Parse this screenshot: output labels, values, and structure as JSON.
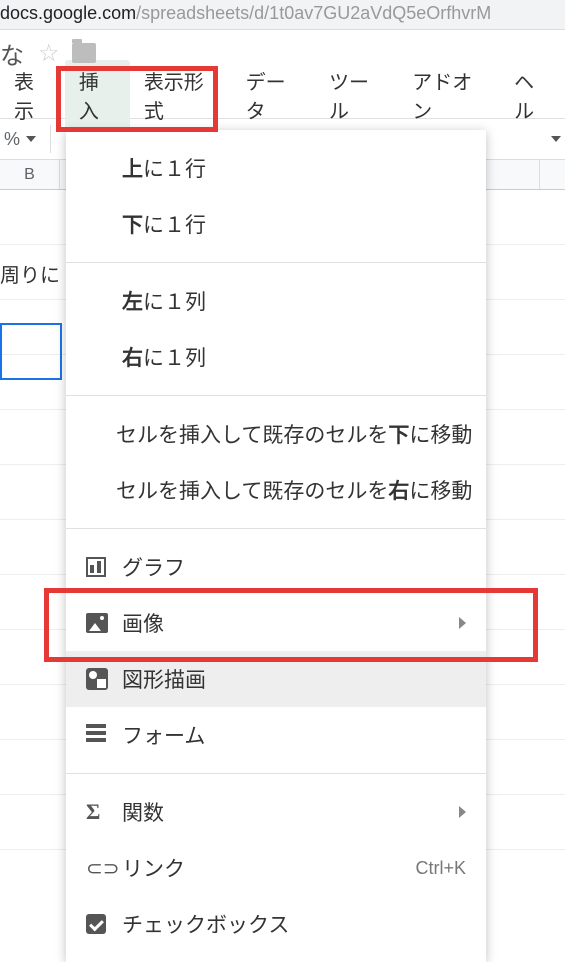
{
  "url": {
    "domain": "docs.google.com",
    "path": "/spreadsheets/d/1t0av7GU2aVdQ5eOrfhvrM"
  },
  "titlebar": {
    "docname_fragment": "な"
  },
  "menubar": {
    "items": [
      "表示",
      "挿入",
      "表示形式",
      "データ",
      "ツール",
      "アドオン",
      "ヘル"
    ]
  },
  "toolbar": {
    "percent_suffix": "%"
  },
  "columns": {
    "B": "B"
  },
  "cell_text": {
    "row1": "周りに"
  },
  "dropdown": {
    "row_above_prefix": "上",
    "row_above_rest": "に１行",
    "row_below_prefix": "下",
    "row_below_rest": "に１行",
    "col_left_prefix": "左",
    "col_left_rest": "に１列",
    "col_right_prefix": "右",
    "col_right_rest": "に１列",
    "shift_down_a": "セルを挿入して既存のセルを",
    "shift_down_b": "下",
    "shift_down_c": "に移動",
    "shift_right_a": "セルを挿入して既存のセルを",
    "shift_right_b": "右",
    "shift_right_c": "に移動",
    "chart": "グラフ",
    "image": "画像",
    "drawing": "図形描画",
    "form": "フォーム",
    "function": "関数",
    "link": "リンク",
    "link_shortcut": "Ctrl+K",
    "checkbox": "チェックボックス"
  }
}
